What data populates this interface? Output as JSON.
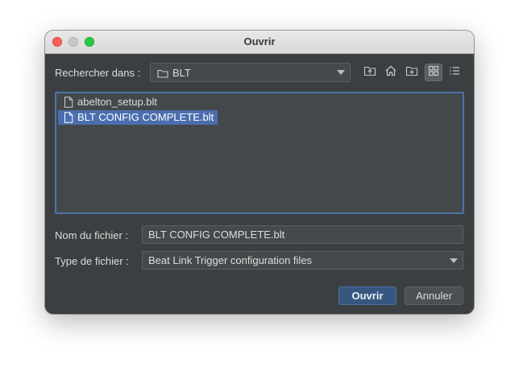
{
  "window": {
    "title": "Ouvrir"
  },
  "lookin": {
    "label": "Rechercher dans :",
    "current_folder": "BLT"
  },
  "toolbar": {
    "icons": [
      "up-folder-icon",
      "home-icon",
      "new-folder-icon",
      "list-view-icon",
      "details-view-icon"
    ]
  },
  "files": [
    {
      "name": "abelton_setup.blt",
      "selected": false
    },
    {
      "name": "BLT CONFIG COMPLETE.blt",
      "selected": true
    }
  ],
  "filename": {
    "label": "Nom du fichier :",
    "value": "BLT CONFIG COMPLETE.blt"
  },
  "filetype": {
    "label": "Type de fichier :",
    "value": "Beat Link Trigger configuration files"
  },
  "buttons": {
    "open": "Ouvrir",
    "cancel": "Annuler"
  },
  "colors": {
    "window_bg": "#3c3f41",
    "selection": "#4b6eaf",
    "accent_border": "#4d73a8",
    "primary_button": "#365880"
  }
}
